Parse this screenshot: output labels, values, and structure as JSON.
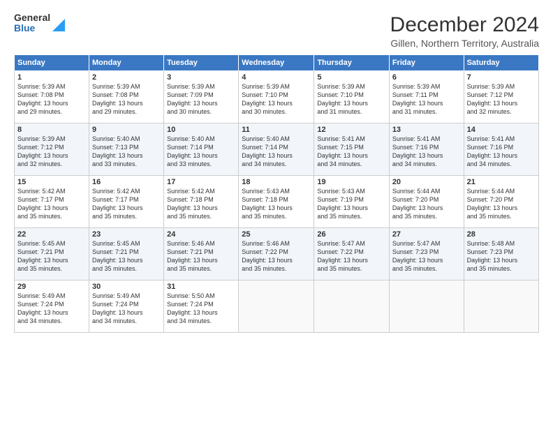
{
  "logo": {
    "general": "General",
    "blue": "Blue"
  },
  "title": "December 2024",
  "subtitle": "Gillen, Northern Territory, Australia",
  "headers": [
    "Sunday",
    "Monday",
    "Tuesday",
    "Wednesday",
    "Thursday",
    "Friday",
    "Saturday"
  ],
  "weeks": [
    [
      {
        "day": "1",
        "info": "Sunrise: 5:39 AM\nSunset: 7:08 PM\nDaylight: 13 hours\nand 29 minutes."
      },
      {
        "day": "2",
        "info": "Sunrise: 5:39 AM\nSunset: 7:08 PM\nDaylight: 13 hours\nand 29 minutes."
      },
      {
        "day": "3",
        "info": "Sunrise: 5:39 AM\nSunset: 7:09 PM\nDaylight: 13 hours\nand 30 minutes."
      },
      {
        "day": "4",
        "info": "Sunrise: 5:39 AM\nSunset: 7:10 PM\nDaylight: 13 hours\nand 30 minutes."
      },
      {
        "day": "5",
        "info": "Sunrise: 5:39 AM\nSunset: 7:10 PM\nDaylight: 13 hours\nand 31 minutes."
      },
      {
        "day": "6",
        "info": "Sunrise: 5:39 AM\nSunset: 7:11 PM\nDaylight: 13 hours\nand 31 minutes."
      },
      {
        "day": "7",
        "info": "Sunrise: 5:39 AM\nSunset: 7:12 PM\nDaylight: 13 hours\nand 32 minutes."
      }
    ],
    [
      {
        "day": "8",
        "info": "Sunrise: 5:39 AM\nSunset: 7:12 PM\nDaylight: 13 hours\nand 32 minutes."
      },
      {
        "day": "9",
        "info": "Sunrise: 5:40 AM\nSunset: 7:13 PM\nDaylight: 13 hours\nand 33 minutes."
      },
      {
        "day": "10",
        "info": "Sunrise: 5:40 AM\nSunset: 7:14 PM\nDaylight: 13 hours\nand 33 minutes."
      },
      {
        "day": "11",
        "info": "Sunrise: 5:40 AM\nSunset: 7:14 PM\nDaylight: 13 hours\nand 34 minutes."
      },
      {
        "day": "12",
        "info": "Sunrise: 5:41 AM\nSunset: 7:15 PM\nDaylight: 13 hours\nand 34 minutes."
      },
      {
        "day": "13",
        "info": "Sunrise: 5:41 AM\nSunset: 7:16 PM\nDaylight: 13 hours\nand 34 minutes."
      },
      {
        "day": "14",
        "info": "Sunrise: 5:41 AM\nSunset: 7:16 PM\nDaylight: 13 hours\nand 34 minutes."
      }
    ],
    [
      {
        "day": "15",
        "info": "Sunrise: 5:42 AM\nSunset: 7:17 PM\nDaylight: 13 hours\nand 35 minutes."
      },
      {
        "day": "16",
        "info": "Sunrise: 5:42 AM\nSunset: 7:17 PM\nDaylight: 13 hours\nand 35 minutes."
      },
      {
        "day": "17",
        "info": "Sunrise: 5:42 AM\nSunset: 7:18 PM\nDaylight: 13 hours\nand 35 minutes."
      },
      {
        "day": "18",
        "info": "Sunrise: 5:43 AM\nSunset: 7:18 PM\nDaylight: 13 hours\nand 35 minutes."
      },
      {
        "day": "19",
        "info": "Sunrise: 5:43 AM\nSunset: 7:19 PM\nDaylight: 13 hours\nand 35 minutes."
      },
      {
        "day": "20",
        "info": "Sunrise: 5:44 AM\nSunset: 7:20 PM\nDaylight: 13 hours\nand 35 minutes."
      },
      {
        "day": "21",
        "info": "Sunrise: 5:44 AM\nSunset: 7:20 PM\nDaylight: 13 hours\nand 35 minutes."
      }
    ],
    [
      {
        "day": "22",
        "info": "Sunrise: 5:45 AM\nSunset: 7:21 PM\nDaylight: 13 hours\nand 35 minutes."
      },
      {
        "day": "23",
        "info": "Sunrise: 5:45 AM\nSunset: 7:21 PM\nDaylight: 13 hours\nand 35 minutes."
      },
      {
        "day": "24",
        "info": "Sunrise: 5:46 AM\nSunset: 7:21 PM\nDaylight: 13 hours\nand 35 minutes."
      },
      {
        "day": "25",
        "info": "Sunrise: 5:46 AM\nSunset: 7:22 PM\nDaylight: 13 hours\nand 35 minutes."
      },
      {
        "day": "26",
        "info": "Sunrise: 5:47 AM\nSunset: 7:22 PM\nDaylight: 13 hours\nand 35 minutes."
      },
      {
        "day": "27",
        "info": "Sunrise: 5:47 AM\nSunset: 7:23 PM\nDaylight: 13 hours\nand 35 minutes."
      },
      {
        "day": "28",
        "info": "Sunrise: 5:48 AM\nSunset: 7:23 PM\nDaylight: 13 hours\nand 35 minutes."
      }
    ],
    [
      {
        "day": "29",
        "info": "Sunrise: 5:49 AM\nSunset: 7:24 PM\nDaylight: 13 hours\nand 34 minutes."
      },
      {
        "day": "30",
        "info": "Sunrise: 5:49 AM\nSunset: 7:24 PM\nDaylight: 13 hours\nand 34 minutes."
      },
      {
        "day": "31",
        "info": "Sunrise: 5:50 AM\nSunset: 7:24 PM\nDaylight: 13 hours\nand 34 minutes."
      },
      {
        "day": "",
        "info": ""
      },
      {
        "day": "",
        "info": ""
      },
      {
        "day": "",
        "info": ""
      },
      {
        "day": "",
        "info": ""
      }
    ]
  ]
}
